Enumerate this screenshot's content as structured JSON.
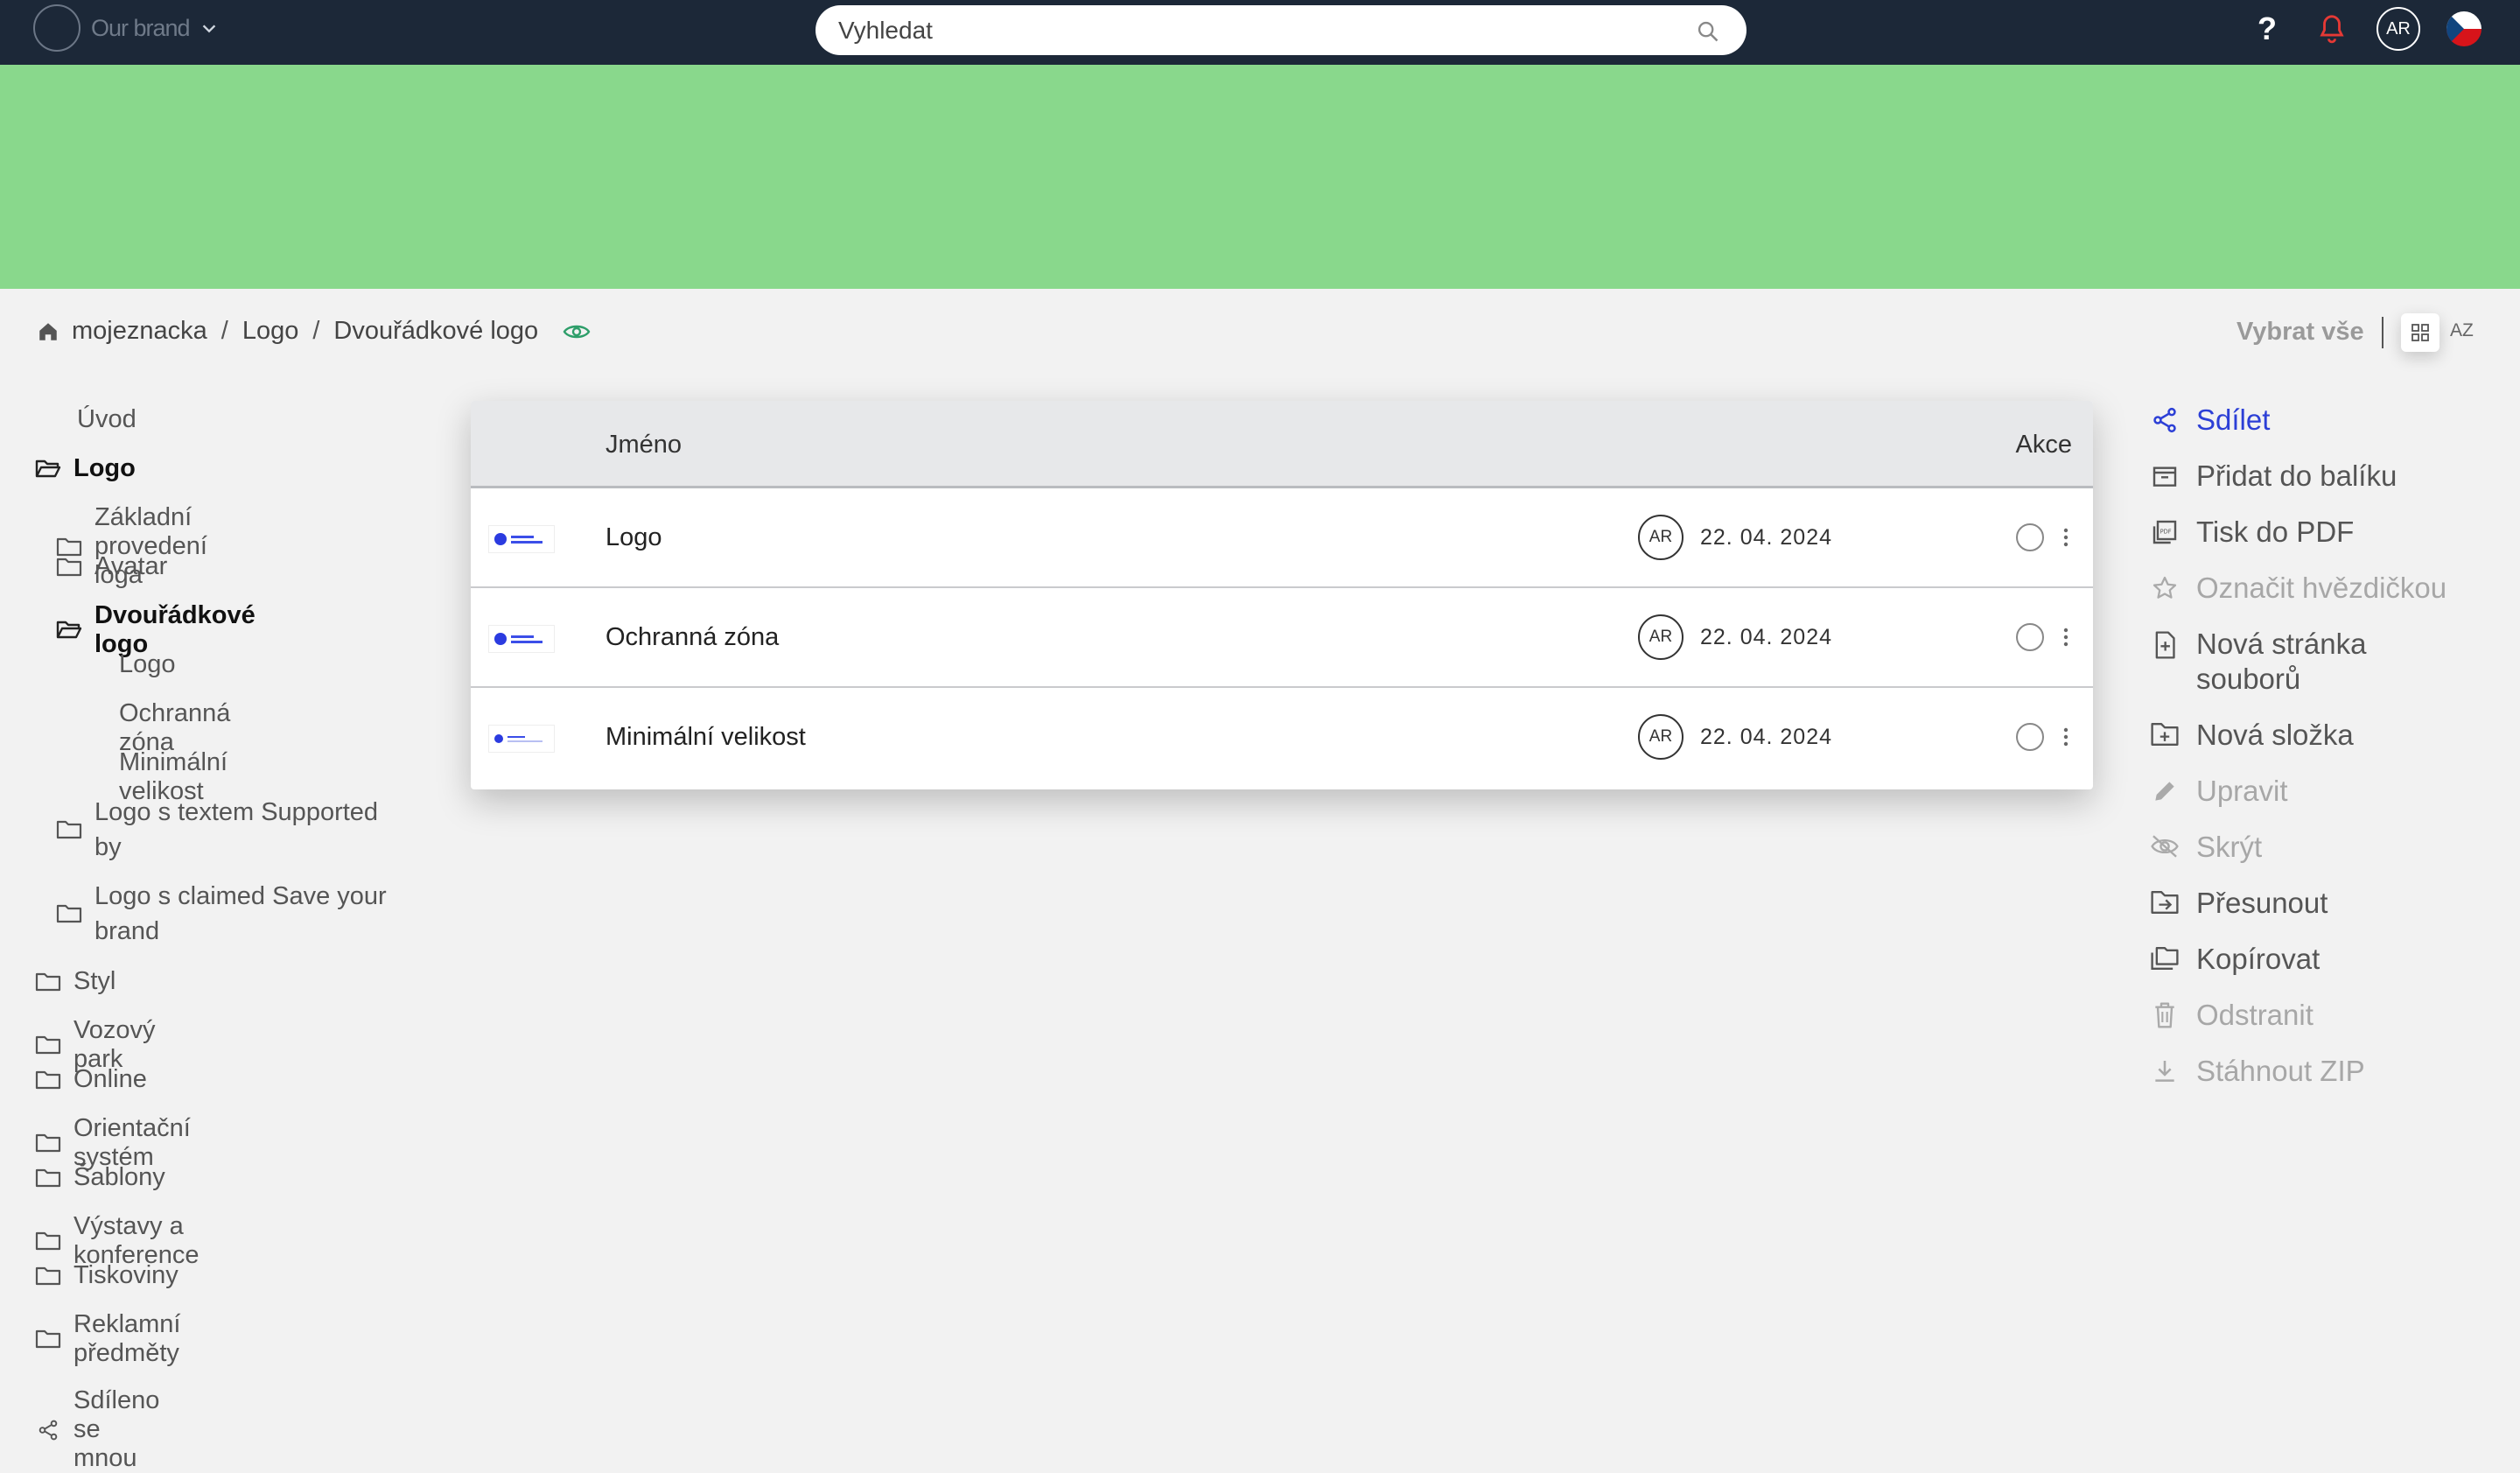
{
  "topbar": {
    "brand_name": "Our brand",
    "search_placeholder": "Vyhledat",
    "help_label": "?",
    "avatar_initials": "AR"
  },
  "breadcrumb": {
    "items": [
      "mojeznacka",
      "Logo",
      "Dvouřádkové logo"
    ],
    "separator": "/"
  },
  "toolbar": {
    "select_all": "Vybrat vše",
    "sort_label": "AZ"
  },
  "sidebar": {
    "items": [
      {
        "label": "Úvod"
      },
      {
        "label": "Logo"
      },
      {
        "label": "Základní provedení loga"
      },
      {
        "label": "Avatar"
      },
      {
        "label": "Dvouřádkové logo"
      },
      {
        "label": "Logo"
      },
      {
        "label": "Ochranná zóna"
      },
      {
        "label": "Minimální velikost"
      },
      {
        "label": "Logo s textem Supported by"
      },
      {
        "label": "Logo s claimed Save your brand"
      },
      {
        "label": "Styl"
      },
      {
        "label": "Vozový park"
      },
      {
        "label": "Online"
      },
      {
        "label": "Orientační systém"
      },
      {
        "label": "Šablony"
      },
      {
        "label": "Výstavy a konference"
      },
      {
        "label": "Tiskoviny"
      },
      {
        "label": "Reklamní předměty"
      },
      {
        "label": "Sdíleno se mnou"
      }
    ]
  },
  "table": {
    "col_name": "Jméno",
    "col_actions": "Akce",
    "rows": [
      {
        "name": "Logo",
        "author": "AR",
        "date": "22. 04. 2024"
      },
      {
        "name": "Ochranná zóna",
        "author": "AR",
        "date": "22. 04. 2024"
      },
      {
        "name": "Minimální velikost",
        "author": "AR",
        "date": "22. 04. 2024"
      }
    ]
  },
  "actions": {
    "items": [
      {
        "label": "Sdílet",
        "icon": "share-icon",
        "state": "primary"
      },
      {
        "label": "Přidat do balíku",
        "icon": "package-icon",
        "state": "enabled"
      },
      {
        "label": "Tisk do PDF",
        "icon": "pdf-icon",
        "state": "enabled"
      },
      {
        "label": "Označit hvězdičkou",
        "icon": "star-icon",
        "state": "disabled"
      },
      {
        "label": "Nová stránka souborů",
        "icon": "new-file-page-icon",
        "state": "enabled"
      },
      {
        "label": "Nová složka",
        "icon": "new-folder-icon",
        "state": "enabled"
      },
      {
        "label": "Upravit",
        "icon": "pencil-icon",
        "state": "disabled"
      },
      {
        "label": "Skrýt",
        "icon": "eye-off-icon",
        "state": "disabled"
      },
      {
        "label": "Přesunout",
        "icon": "move-icon",
        "state": "enabled"
      },
      {
        "label": "Kopírovat",
        "icon": "copy-icon",
        "state": "enabled"
      },
      {
        "label": "Odstranit",
        "icon": "trash-icon",
        "state": "disabled"
      },
      {
        "label": "Stáhnout ZIP",
        "icon": "download-icon",
        "state": "disabled"
      }
    ]
  },
  "colors": {
    "topbar": "#1c2838",
    "banner": "#89d88c",
    "primary": "#2c3fd6",
    "notification": "#e53935"
  }
}
